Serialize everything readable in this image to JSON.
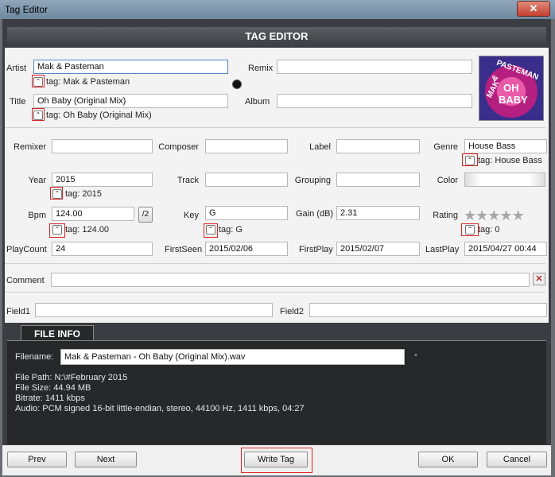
{
  "window": {
    "title": "Tag Editor",
    "close_glyph": "✕"
  },
  "header": {
    "title": "TAG EDITOR"
  },
  "fields": {
    "artist": {
      "label": "Artist",
      "value": "Mak & Pasteman",
      "tag": "tag: Mak & Pasteman"
    },
    "remix": {
      "label": "Remix",
      "value": ""
    },
    "title": {
      "label": "Title",
      "value": "Oh Baby (Original Mix)",
      "tag": "tag: Oh Baby (Original Mix)"
    },
    "album": {
      "label": "Album",
      "value": ""
    },
    "remixer": {
      "label": "Remixer",
      "value": ""
    },
    "composer": {
      "label": "Composer",
      "value": ""
    },
    "label": {
      "label": "Label",
      "value": ""
    },
    "genre": {
      "label": "Genre",
      "value": "House Bass",
      "tag": "tag: House Bass"
    },
    "year": {
      "label": "Year",
      "value": "2015",
      "tag": "tag: 2015"
    },
    "track": {
      "label": "Track",
      "value": ""
    },
    "grouping": {
      "label": "Grouping",
      "value": ""
    },
    "color": {
      "label": "Color"
    },
    "bpm": {
      "label": "Bpm",
      "value": "124.00",
      "tag": "tag: 124.00",
      "half_button": "/2"
    },
    "key": {
      "label": "Key",
      "value": "G",
      "tag": "tag: G"
    },
    "gain": {
      "label": "Gain (dB)",
      "value": "2.31"
    },
    "rating": {
      "label": "Rating",
      "value": 0,
      "max": 5,
      "tag": "tag: 0"
    },
    "playcount": {
      "label": "PlayCount",
      "value": "24"
    },
    "firstseen": {
      "label": "FirstSeen",
      "value": "2015/02/06"
    },
    "firstplay": {
      "label": "FirstPlay",
      "value": "2015/02/07"
    },
    "lastplay": {
      "label": "LastPlay",
      "value": "2015/04/27 00:44"
    },
    "comment": {
      "label": "Comment",
      "value": ""
    },
    "field1": {
      "label": "Field1",
      "value": ""
    },
    "field2": {
      "label": "Field2",
      "value": ""
    }
  },
  "artwork": {
    "line1": "MAK",
    "line2": "&",
    "line3": "PASTEMAN",
    "line4": "OH",
    "line5": "BABY"
  },
  "file_info": {
    "tab": "FILE INFO",
    "filename_label": "Filename:",
    "filename": "Mak & Pasteman - Oh Baby (Original Mix).wav",
    "path": "File Path: N:\\#February 2015",
    "size": "File Size: 44.94 MB",
    "bitrate": "Bitrate: 1411 kbps",
    "audio": "Audio: PCM signed 16-bit little-endian, stereo, 44100 Hz, 1411 kbps, 04:27"
  },
  "buttons": {
    "prev": "Prev",
    "next": "Next",
    "write_tag": "Write Tag",
    "ok": "OK",
    "cancel": "Cancel"
  },
  "colors": {
    "accent_red": "#d22222",
    "panel": "#f3f3f3",
    "dark": "#262829"
  },
  "icons": {
    "tag": "tag-arrow-icon",
    "star": "★"
  }
}
